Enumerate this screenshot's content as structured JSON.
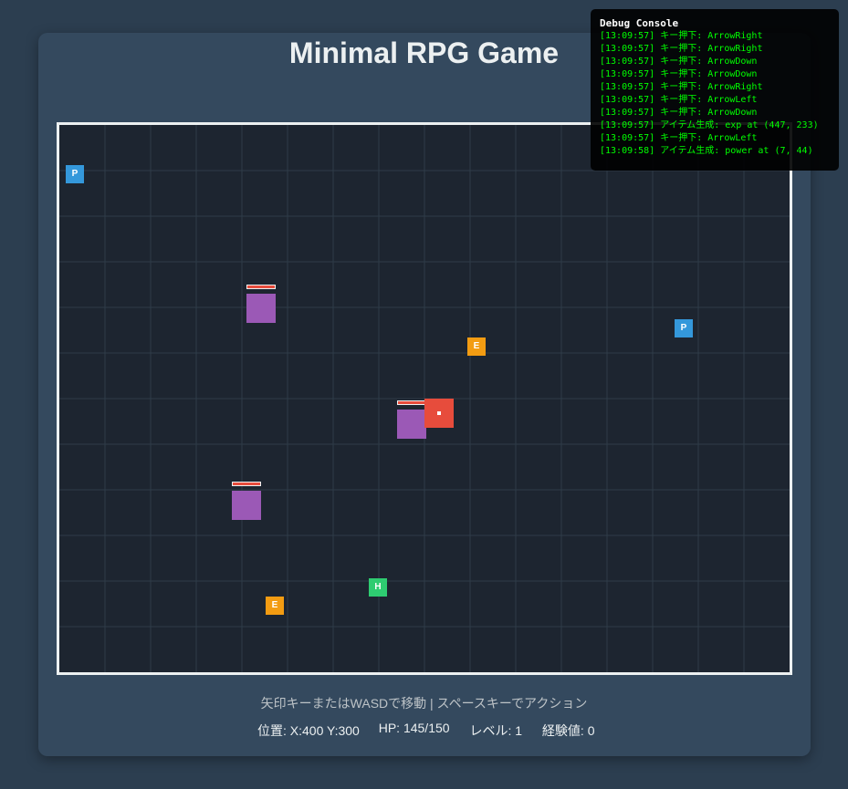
{
  "game": {
    "title": "Minimal RPG Game",
    "instructions": "矢印キーまたはWASDで移動 | スペースキーでアクション",
    "stats": {
      "position": "位置: X:400 Y:300",
      "hp": "HP: 145/150",
      "level": "レベル: 1",
      "exp": "経験値: 0"
    }
  },
  "items": [
    {
      "label": "P",
      "kind": "power",
      "color": "#3498db"
    },
    {
      "label": "P",
      "kind": "power",
      "color": "#3498db"
    },
    {
      "label": "E",
      "kind": "exp",
      "color": "#f39c12"
    },
    {
      "label": "E",
      "kind": "exp",
      "color": "#f39c12"
    },
    {
      "label": "H",
      "kind": "health",
      "color": "#2ecc71"
    }
  ],
  "enemies": [
    {
      "color": "#9b59b6",
      "hp_bar_color": "#e74c3c"
    },
    {
      "color": "#9b59b6",
      "hp_bar_color": "#e74c3c"
    },
    {
      "color": "#9b59b6",
      "hp_bar_color": "#e74c3c"
    }
  ],
  "player": {
    "color": "#e74c3c"
  },
  "debug": {
    "title": "Debug Console",
    "logs": [
      "[13:09:57] キー押下: ArrowRight",
      "[13:09:57] キー押下: ArrowRight",
      "[13:09:57] キー押下: ArrowDown",
      "[13:09:57] キー押下: ArrowDown",
      "[13:09:57] キー押下: ArrowRight",
      "[13:09:57] キー押下: ArrowLeft",
      "[13:09:57] キー押下: ArrowDown",
      "[13:09:57] アイテム生成: exp at (447, 233)",
      "[13:09:57] キー押下: ArrowLeft",
      "[13:09:58] アイテム生成: power at (7, 44)"
    ]
  }
}
